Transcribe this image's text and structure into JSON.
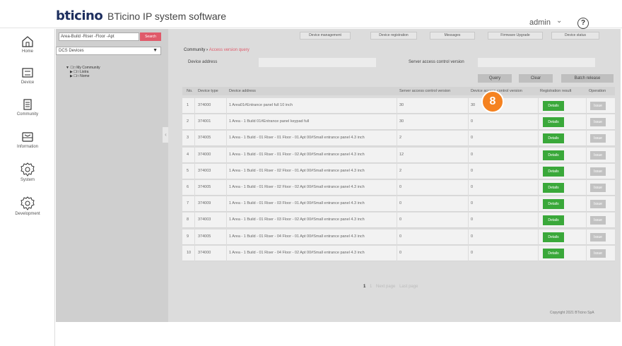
{
  "header": {
    "logo": "bticino",
    "title": "BTicino IP system software",
    "user": "admin",
    "help": "?"
  },
  "nav": [
    {
      "label": "Home",
      "icon": "home-icon"
    },
    {
      "label": "Device",
      "icon": "device-icon"
    },
    {
      "label": "Community",
      "icon": "community-icon"
    },
    {
      "label": "Information",
      "icon": "information-icon"
    },
    {
      "label": "System",
      "icon": "system-gear-icon"
    },
    {
      "label": "Development",
      "icon": "development-gear-icon"
    }
  ],
  "tree_panel": {
    "address_input": "Area-Build -Riser -Floor -Apt",
    "address_button": "Search",
    "device_select": "DCS Devices",
    "tree_items": [
      "My Community",
      "Listra",
      "Nome"
    ]
  },
  "topbar": [
    "Device management",
    "Device registration",
    "Messages",
    "Firmware Upgrade",
    "Device status"
  ],
  "breadcrumb": {
    "root": "Community",
    "current": "Access version query"
  },
  "form": {
    "device_address_label": "Device address",
    "server_version_label": "Server access control version",
    "query": "Query",
    "clear": "Clear",
    "batch_release": "Batch release"
  },
  "table": {
    "columns": [
      "No.",
      "Device type",
      "Device address",
      "Server access control version",
      "Device access control version",
      "Registration result",
      "Operation"
    ],
    "rows": [
      {
        "no": "1",
        "type": "374000",
        "address": "1 Area01#Entrance panel full 10 inch",
        "server": "30",
        "device": "30",
        "reg": "Details",
        "op": "Issue"
      },
      {
        "no": "2",
        "type": "374001",
        "address": "1 Area - 1 Build 01#Entrance panel keypad full",
        "server": "30",
        "device": "0",
        "reg": "Details",
        "op": "Issue"
      },
      {
        "no": "3",
        "type": "374005",
        "address": "1 Area - 1 Build - 01 Riser - 01 Floor - 01 Apt 00#Small entrance panel 4.3 inch",
        "server": "2",
        "device": "0",
        "reg": "Details",
        "op": "Issue"
      },
      {
        "no": "4",
        "type": "374000",
        "address": "1 Area - 1 Build - 01 Riser - 01 Floor - 02 Apt 00#Small entrance panel 4.3 inch",
        "server": "12",
        "device": "0",
        "reg": "Details",
        "op": "Issue"
      },
      {
        "no": "5",
        "type": "374003",
        "address": "1 Area - 1 Build - 01 Riser - 02 Floor - 01 Apt 00#Small entrance panel 4.3 inch",
        "server": "2",
        "device": "0",
        "reg": "Details",
        "op": "Issue"
      },
      {
        "no": "6",
        "type": "374005",
        "address": "1 Area - 1 Build - 01 Riser - 02 Floor - 02 Apt 00#Small entrance panel 4.3 inch",
        "server": "0",
        "device": "0",
        "reg": "Details",
        "op": "Issue"
      },
      {
        "no": "7",
        "type": "374009",
        "address": "1 Area - 1 Build - 01 Riser - 03 Floor - 01 Apt 00#Small entrance panel 4.3 inch",
        "server": "0",
        "device": "0",
        "reg": "Details",
        "op": "Issue"
      },
      {
        "no": "8",
        "type": "374003",
        "address": "1 Area - 1 Build - 01 Riser - 03 Floor - 02 Apt 00#Small entrance panel 4.3 inch",
        "server": "0",
        "device": "0",
        "reg": "Details",
        "op": "Issue"
      },
      {
        "no": "9",
        "type": "374005",
        "address": "1 Area - 1 Build - 01 Riser - 04 Floor - 01 Apt 00#Small entrance panel 4.3 inch",
        "server": "0",
        "device": "0",
        "reg": "Details",
        "op": "Issue"
      },
      {
        "no": "10",
        "type": "374000",
        "address": "1 Area - 1 Build - 01 Riser - 04 Floor - 02 Apt 00#Small entrance panel 4.3 inch",
        "server": "0",
        "device": "0",
        "reg": "Details",
        "op": "Issue"
      }
    ]
  },
  "pager": {
    "current": "1",
    "page": "1",
    "next": "Next page",
    "last": "Last page"
  },
  "copyright": "Copyright 2021 BTicino SpA",
  "badge": "8",
  "colors": {
    "accent": "#e05a6a",
    "green": "#3aa83a",
    "badge": "#f58220"
  }
}
